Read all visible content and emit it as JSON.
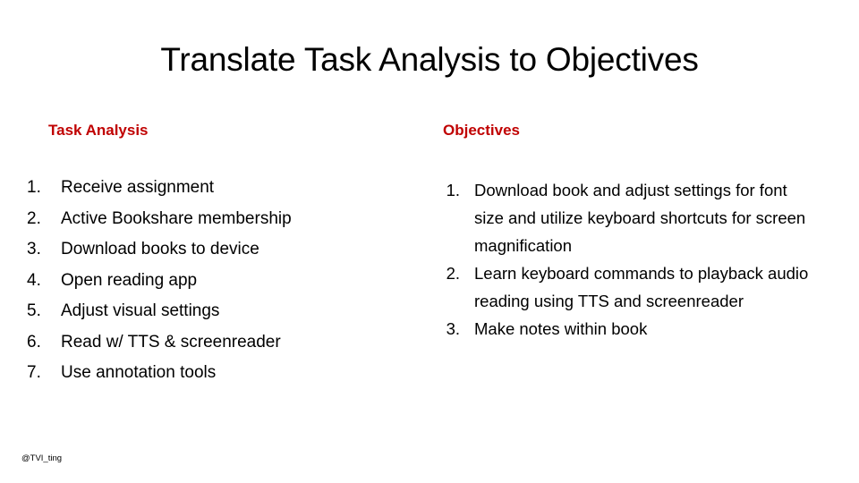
{
  "slide": {
    "title": "Translate Task Analysis to Objectives",
    "footer_handle": "@TVI_ting",
    "accent_color": "#C00000",
    "background_color": "#FFFFFF",
    "text_color": "#000000"
  },
  "columns": {
    "left": {
      "heading": "Task Analysis",
      "items": [
        {
          "marker": "1.",
          "text": "Receive assignment"
        },
        {
          "marker": "2.",
          "text": "Active Bookshare membership"
        },
        {
          "marker": "3.",
          "text": "Download books to device"
        },
        {
          "marker": "4.",
          "text": "Open reading app"
        },
        {
          "marker": "5.",
          "text": "Adjust visual settings"
        },
        {
          "marker": "6.",
          "text": "Read w/ TTS & screenreader"
        },
        {
          "marker": "7.",
          "text": "Use annotation tools"
        }
      ]
    },
    "right": {
      "heading": "Objectives",
      "items": [
        {
          "marker": "1.",
          "text": "Download book and adjust settings for font size and utilize keyboard shortcuts for screen magnification"
        },
        {
          "marker": "2.",
          "text": "Learn keyboard commands to playback audio reading using TTS and screenreader"
        },
        {
          "marker": "3.",
          "text": "Make notes within book"
        }
      ]
    }
  }
}
